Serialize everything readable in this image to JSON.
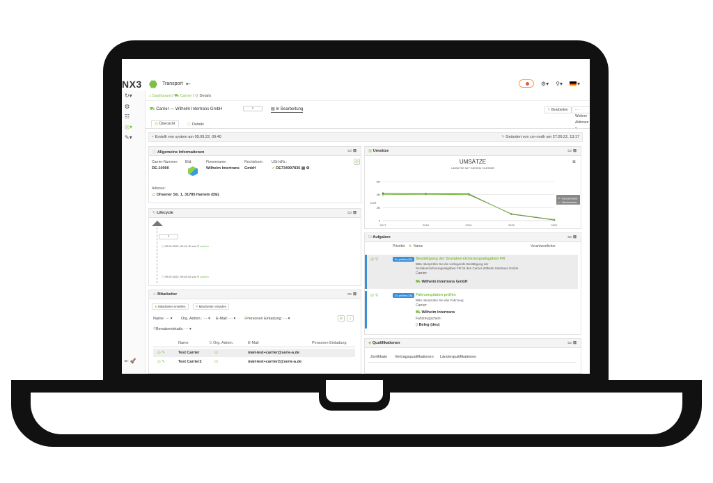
{
  "app": {
    "logo": "NX3",
    "name": "Transport",
    "collapse_icon": "collapse-icon",
    "accent_color": "#7cc242",
    "task_color": "#3a8fd9"
  },
  "sidebar": {
    "items": [
      {
        "icon": "history-icon",
        "glyph": "↻▾"
      },
      {
        "icon": "dashboard-icon",
        "glyph": "◍"
      },
      {
        "icon": "list-icon",
        "glyph": "☷"
      },
      {
        "icon": "eye-icon",
        "glyph": "◎▾"
      },
      {
        "icon": "tools-icon",
        "glyph": "✎▾"
      }
    ],
    "bottom": "⇤ 🚀"
  },
  "breadcrumb": {
    "dashboard": "Dashboard",
    "carrier": "Carrier",
    "details": "Details"
  },
  "header": {
    "title_prefix": "Carrier",
    "title_name": "Wilhelm Intertrans GmbH",
    "status": "In Bearbeitung",
    "edit_label": "Bearbeiten",
    "more_label": "Weitere Aktionen"
  },
  "tabs": [
    {
      "label": "Übersicht"
    },
    {
      "label": "Details"
    }
  ],
  "info_bar": {
    "created": "Erstellt von system am 09.09.22, 09:40",
    "changed": "Geändert von crn-north am 27.09.22, 13:17"
  },
  "general": {
    "title": "Allgemeine Informationen",
    "carrier_no_label": "Carrier-Nummer:",
    "carrier_no": "DE-10000",
    "image_label": "Bild:",
    "company_label": "Firmenname:",
    "company": "Wilhelm Intertrans",
    "legal_label": "Rechtsform:",
    "legal": "GmbH",
    "vat_label": "USt-IdNr.:",
    "vat": "DE734997836",
    "address_label": "Adresse:",
    "address": "Ohsener Str. 1, 31785 Hameln (DE)"
  },
  "lifecycle": {
    "title": "Lifecycle",
    "entries": [
      {
        "time": "09.09.2022, 09:41:10",
        "user": "system"
      },
      {
        "time": "09.09.2022, 09:40:43",
        "user": "system"
      }
    ],
    "via": "von"
  },
  "staff": {
    "title": "Mitarbeiter",
    "create_label": "Mitarbeiter erstellen",
    "invite_label": "Mitarbeiter einladen",
    "filters": {
      "name": "Name: ···",
      "org_admin": "Org. Admin.: ···",
      "email": "E-Mail: ···",
      "invitation": "Personen Einladung: ···",
      "user_details": "Benutzerdetails: ···"
    },
    "columns": [
      "Name",
      "Org. Admin.",
      "E-Mail",
      "Personen Einladung"
    ],
    "rows": [
      {
        "name": "Test Carrier",
        "email": "mail-test+carrier@serie-a.de"
      },
      {
        "name": "Test Carrier2",
        "email": "mail-test+carrier2@serie-a.de"
      }
    ]
  },
  "revenue": {
    "panel_title": "Umsätze",
    "unit_label": "EUR"
  },
  "chart_data": {
    "type": "line",
    "title": "UMSÄTZE",
    "subtitle": "UMSÄTZE MIT DIESEM CARRIER",
    "x": [
      "2017",
      "2018",
      "2019",
      "2020",
      "2021"
    ],
    "ylim": [
      0,
      6000000
    ],
    "yticks": [
      "0",
      "2M",
      "4M",
      "6M"
    ],
    "legend": "right",
    "series": [
      {
        "name": "Deutschland",
        "values": [
          4200000,
          4150000,
          4100000,
          1000000,
          100000
        ],
        "color": "#555555"
      },
      {
        "name": "Niederlande",
        "values": [
          4000000,
          4050000,
          4000000,
          1050000,
          150000
        ],
        "color": "#7cc242"
      }
    ]
  },
  "tasks": {
    "title": "Aufgaben",
    "columns": {
      "priority": "Priorität",
      "name": "Name",
      "responsible": "Verantwortlicher"
    },
    "items": [
      {
        "chip": "Zu prüfen (91)",
        "title": "Bestätigung der Sozialversicherungsabgaben FR",
        "desc1": "Bitte überprüfen Sie die vorliegende Bestätigung der",
        "desc2": "Sozialversicherungsabgaben FR für den Carrier Wilhelm Intertrans GmbH.",
        "field": "Carrier:",
        "link": "Wilhelm Intertrans GmbH"
      },
      {
        "chip": "Zu prüfen (25)",
        "title": "Fahrzeugdaten prüfen",
        "desc1": "Bitte überprüfen Sie das Fahrzeug",
        "field": "Carrier:",
        "link": "Wilhelm Intertrans",
        "field2": "Fahrzeugschein:",
        "link2": "Beleg (deu)"
      }
    ]
  },
  "qualifications": {
    "title": "Qualifikationen",
    "tabs": [
      "Zertifikate",
      "Vertragsqualifikationen",
      "Länderqualifikationen"
    ]
  }
}
